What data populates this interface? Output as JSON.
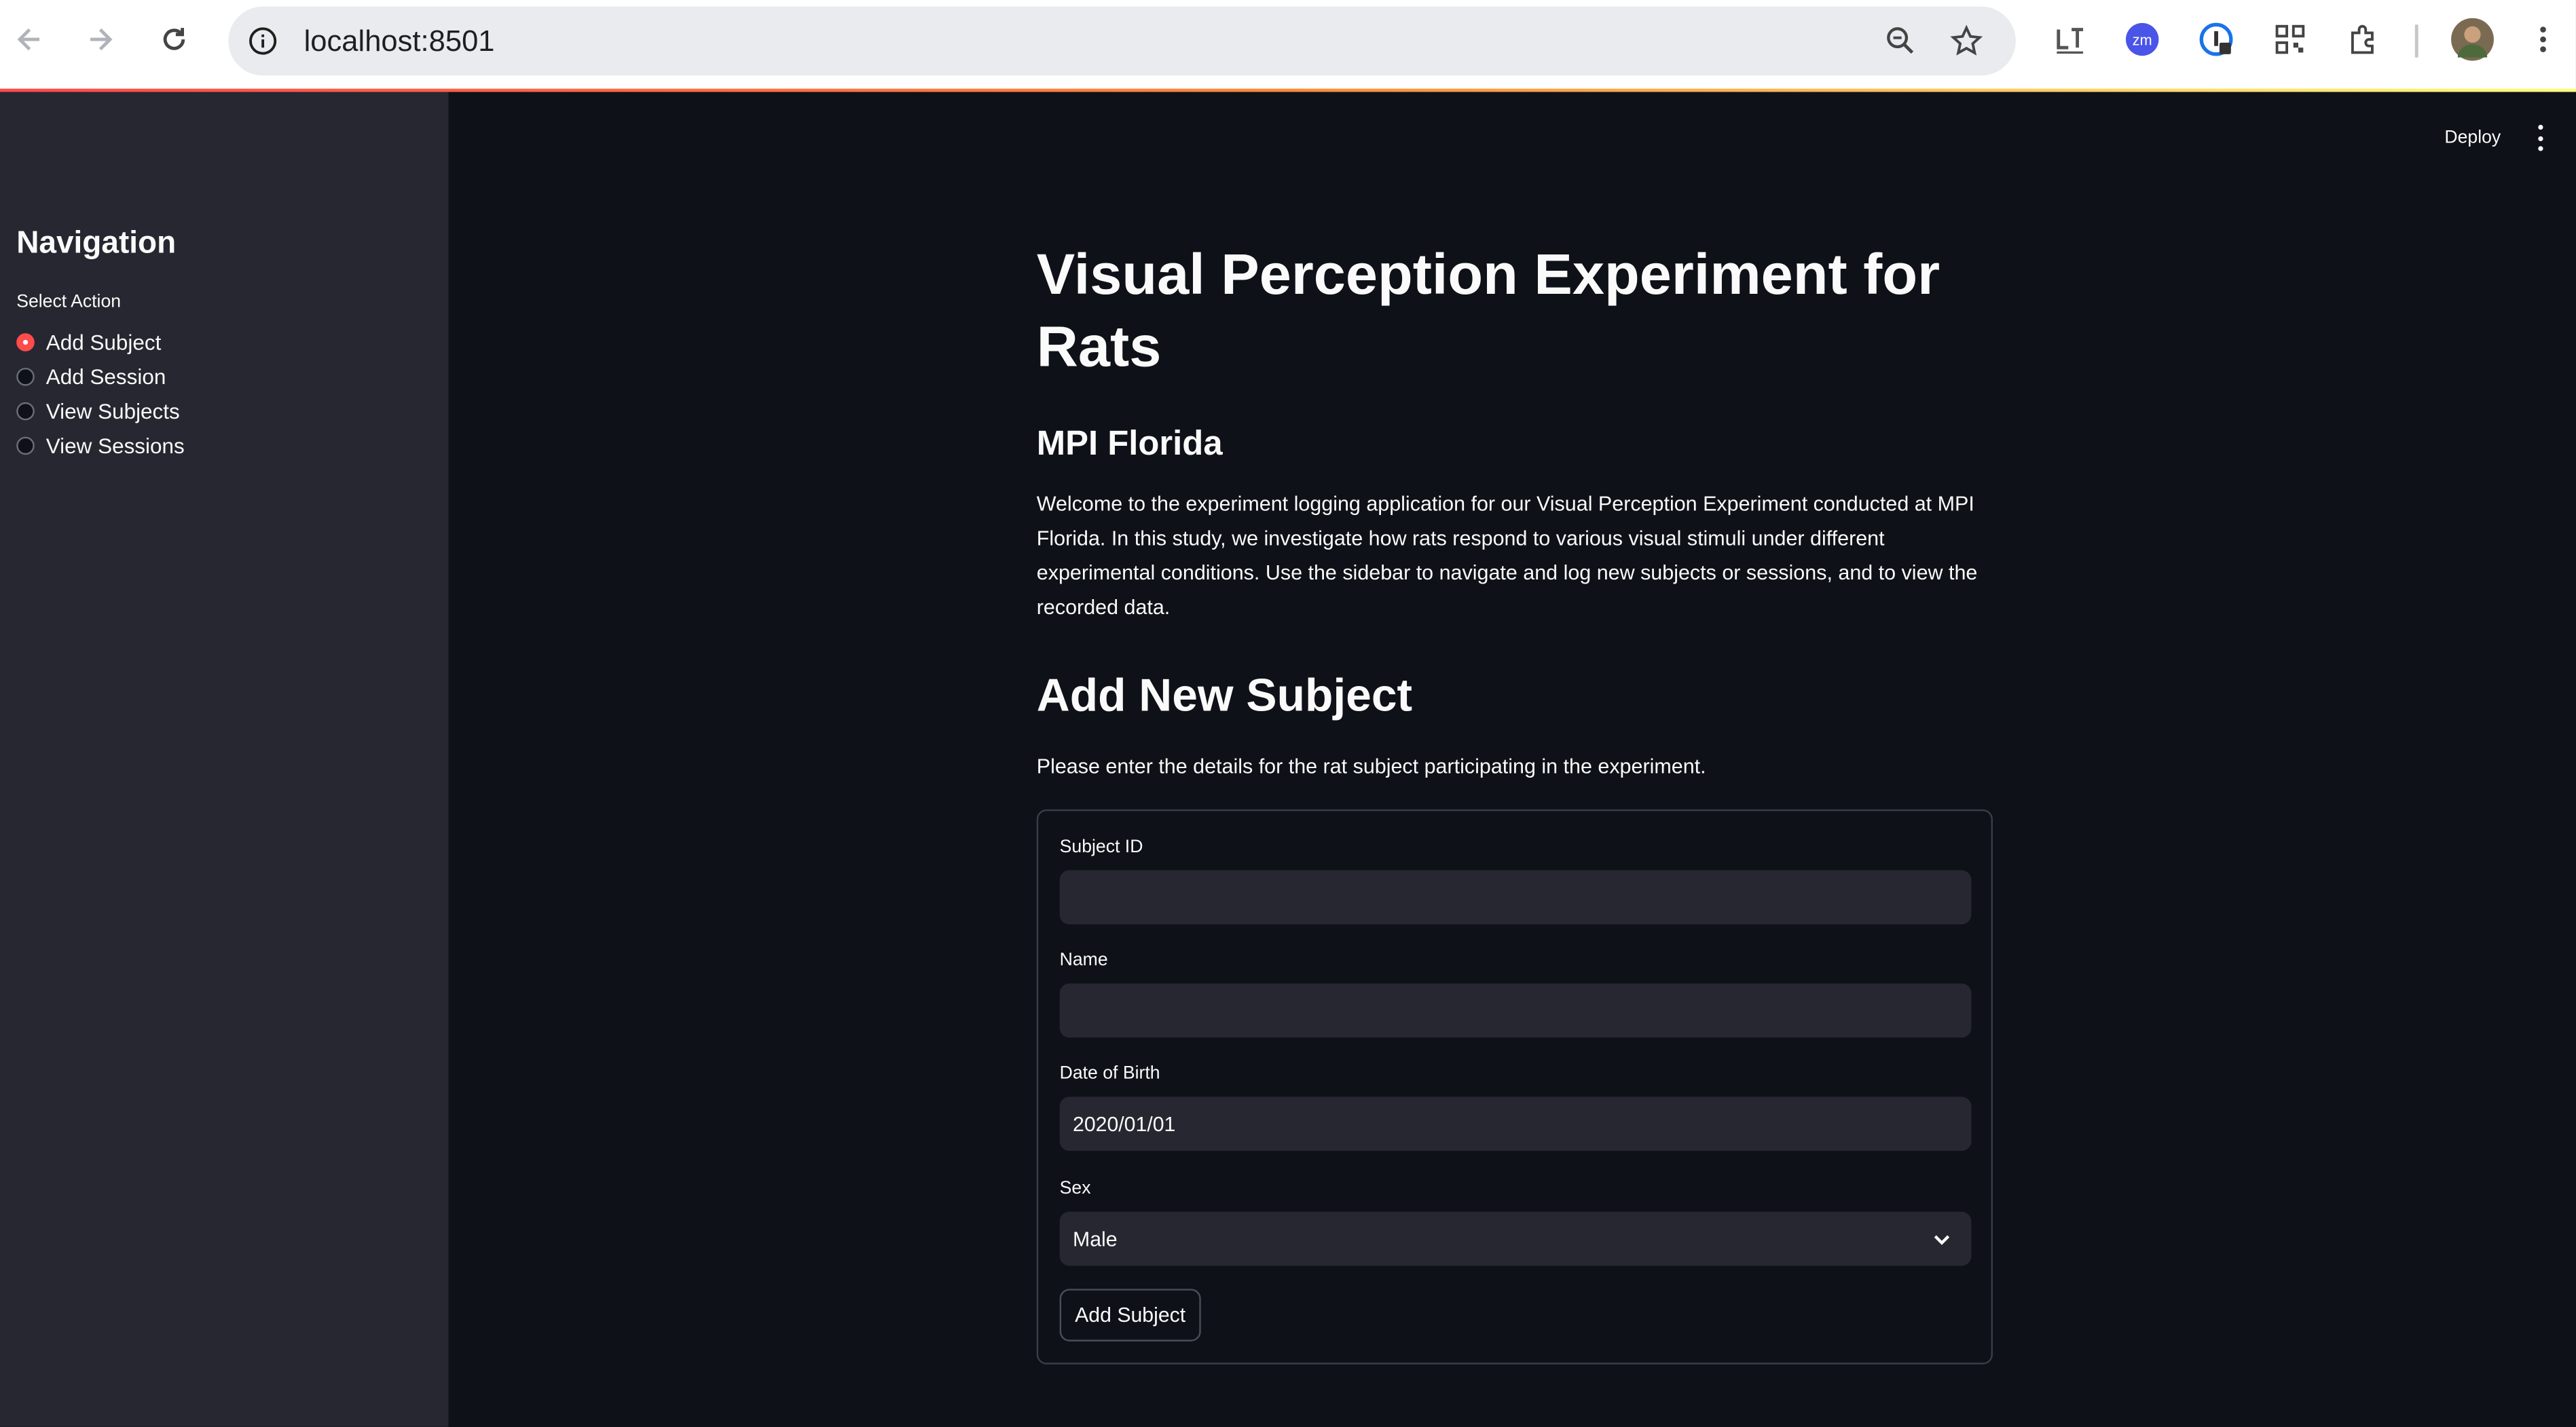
{
  "browser": {
    "url": "localhost:8501"
  },
  "toolbar": {
    "deploy_label": "Deploy"
  },
  "sidebar": {
    "title": "Navigation",
    "radio_label": "Select Action",
    "items": [
      {
        "label": "Add Subject",
        "checked": true
      },
      {
        "label": "Add Session",
        "checked": false
      },
      {
        "label": "View Subjects",
        "checked": false
      },
      {
        "label": "View Sessions",
        "checked": false
      }
    ]
  },
  "main": {
    "title": "Visual Perception Experiment for Rats",
    "subtitle": "MPI Florida",
    "intro": "Welcome to the experiment logging application for our Visual Perception Experiment conducted at MPI Florida. In this study, we investigate how rats respond to various visual stimuli under different experimental conditions. Use the sidebar to navigate and log new subjects or sessions, and to view the recorded data.",
    "section_title": "Add New Subject",
    "section_desc": "Please enter the details for the rat subject participating in the experiment."
  },
  "form": {
    "subject_id_label": "Subject ID",
    "subject_id_value": "",
    "name_label": "Name",
    "name_value": "",
    "dob_label": "Date of Birth",
    "dob_value": "2020/01/01",
    "sex_label": "Sex",
    "sex_value": "Male",
    "submit_label": "Add Subject"
  },
  "colors": {
    "background": "#0e1117",
    "sidebar": "#262730",
    "accent": "#ff4b4b"
  }
}
